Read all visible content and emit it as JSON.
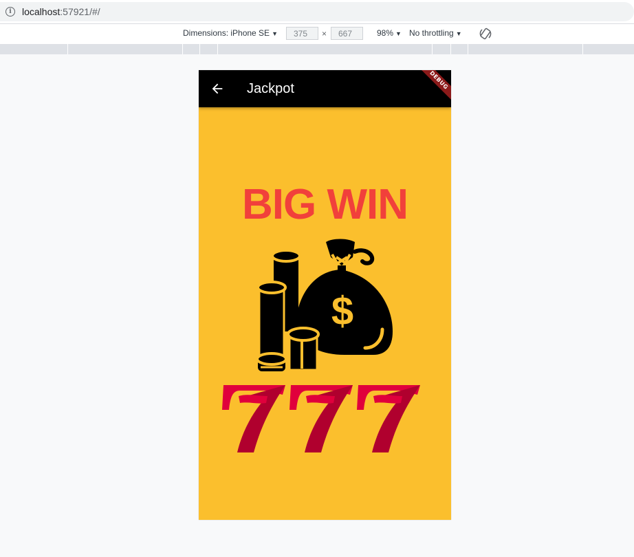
{
  "browser": {
    "url_host": "localhost",
    "url_rest": ":57921/#/"
  },
  "devtools": {
    "dimensions_label": "Dimensions: iPhone SE",
    "width": "375",
    "height": "667",
    "times": "×",
    "zoom": "98%",
    "throttling": "No throttling"
  },
  "app": {
    "title": "Jackpot",
    "debug_banner": "DEBUG",
    "headline": "BIG WIN",
    "colors": {
      "background": "#fbbf2d",
      "appbar": "#000000",
      "headline": "#f1403b",
      "seven_light": "#e0003c",
      "seven_dark": "#b0002e"
    },
    "icons": [
      "back-arrow-icon",
      "money-bag-icon",
      "coin-stack-icon",
      "slot-777-icon"
    ]
  }
}
